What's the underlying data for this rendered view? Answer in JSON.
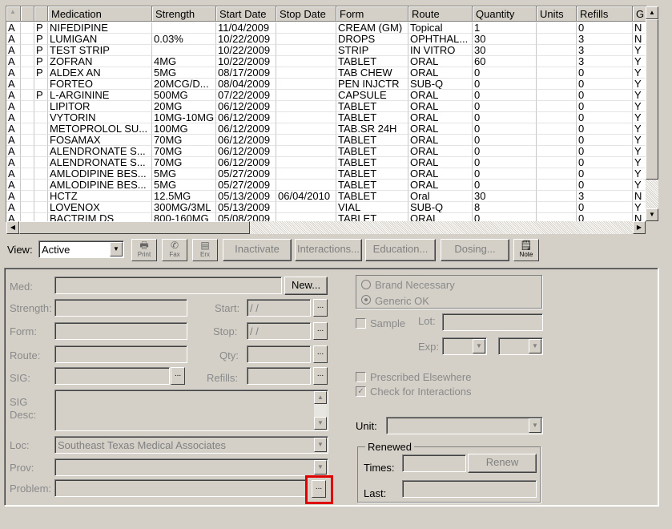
{
  "grid": {
    "columns": [
      "",
      "",
      "",
      "Medication",
      "Strength",
      "Start Date",
      "Stop Date",
      "Form",
      "Route",
      "Quantity",
      "Units",
      "Refills",
      "G"
    ],
    "rows": [
      [
        "A",
        "",
        "P",
        "NIFEDIPINE",
        "",
        "11/04/2009",
        "",
        "CREAM (GM)",
        "Topical",
        "1",
        "",
        "0",
        "N"
      ],
      [
        "A",
        "",
        "P",
        "LUMIGAN",
        "0.03%",
        "10/22/2009",
        "",
        "DROPS",
        "OPHTHAL...",
        "30",
        "",
        "3",
        "N"
      ],
      [
        "A",
        "",
        "P",
        "TEST STRIP",
        "",
        "10/22/2009",
        "",
        "STRIP",
        "IN VITRO",
        "30",
        "",
        "3",
        "Y"
      ],
      [
        "A",
        "",
        "P",
        "ZOFRAN",
        "4MG",
        "10/22/2009",
        "",
        "TABLET",
        "ORAL",
        "60",
        "",
        "3",
        "Y"
      ],
      [
        "A",
        "",
        "P",
        "ALDEX AN",
        "5MG",
        "08/17/2009",
        "",
        "TAB CHEW",
        "ORAL",
        "0",
        "",
        "0",
        "Y"
      ],
      [
        "A",
        "",
        "",
        "FORTEO",
        "20MCG/D...",
        "08/04/2009",
        "",
        "PEN INJCTR",
        "SUB-Q",
        "0",
        "",
        "0",
        "Y"
      ],
      [
        "A",
        "",
        "P",
        "L-ARGININE",
        "500MG",
        "07/22/2009",
        "",
        "CAPSULE",
        "ORAL",
        "0",
        "",
        "0",
        "Y"
      ],
      [
        "A",
        "",
        "",
        "LIPITOR",
        "20MG",
        "06/12/2009",
        "",
        "TABLET",
        "ORAL",
        "0",
        "",
        "0",
        "Y"
      ],
      [
        "A",
        "",
        "",
        "VYTORIN",
        "10MG-10MG",
        "06/12/2009",
        "",
        "TABLET",
        "ORAL",
        "0",
        "",
        "0",
        "Y"
      ],
      [
        "A",
        "",
        "",
        "METOPROLOL SU...",
        "100MG",
        "06/12/2009",
        "",
        "TAB.SR 24H",
        "ORAL",
        "0",
        "",
        "0",
        "Y"
      ],
      [
        "A",
        "",
        "",
        "FOSAMAX",
        "70MG",
        "06/12/2009",
        "",
        "TABLET",
        "ORAL",
        "0",
        "",
        "0",
        "Y"
      ],
      [
        "A",
        "",
        "",
        "ALENDRONATE S...",
        "70MG",
        "06/12/2009",
        "",
        "TABLET",
        "ORAL",
        "0",
        "",
        "0",
        "Y"
      ],
      [
        "A",
        "",
        "",
        "ALENDRONATE S...",
        "70MG",
        "06/12/2009",
        "",
        "TABLET",
        "ORAL",
        "0",
        "",
        "0",
        "Y"
      ],
      [
        "A",
        "",
        "",
        "AMLODIPINE BES...",
        "5MG",
        "05/27/2009",
        "",
        "TABLET",
        "ORAL",
        "0",
        "",
        "0",
        "Y"
      ],
      [
        "A",
        "",
        "",
        "AMLODIPINE BES...",
        "5MG",
        "05/27/2009",
        "",
        "TABLET",
        "ORAL",
        "0",
        "",
        "0",
        "Y"
      ],
      [
        "A",
        "",
        "",
        "HCTZ",
        "12.5MG",
        "05/13/2009",
        "06/04/2010",
        "TABLET",
        "Oral",
        "30",
        "",
        "3",
        "N"
      ],
      [
        "A",
        "",
        "",
        "LOVENOX",
        "300MG/3ML",
        "05/13/2009",
        "",
        "VIAL",
        "SUB-Q",
        "8",
        "",
        "0",
        "Y"
      ],
      [
        "A",
        "",
        "",
        "BACTRIM DS",
        "800-160MG",
        "05/08/2009",
        "",
        "TABLET",
        "ORAL",
        "0",
        "",
        "0",
        "N"
      ]
    ]
  },
  "toolbar": {
    "view_label": "View:",
    "view_value": "Active",
    "print": "Print",
    "fax": "Fax",
    "erx": "Erx",
    "inactivate": "Inactivate",
    "interactions": "Interactions...",
    "education": "Education...",
    "dosing": "Dosing...",
    "note": "Note"
  },
  "form": {
    "med": "Med:",
    "new_button": "New...",
    "strength": "Strength:",
    "form": "Form:",
    "route": "Route:",
    "sig": "SIG:",
    "sig_desc_1": "SIG",
    "sig_desc_2": "Desc:",
    "loc": "Loc:",
    "loc_value": "Southeast Texas Medical Associates",
    "prov": "Prov:",
    "problem": "Problem:",
    "start": "Start:",
    "start_value": " / /",
    "stop": "Stop:",
    "stop_value": " / /",
    "qty": "Qty:",
    "refills": "Refills:",
    "brand_necessary": "Brand Necessary",
    "generic_ok": "Generic OK",
    "sample": "Sample",
    "lot": "Lot:",
    "exp": "Exp:",
    "prescribed_elsewhere": "Prescribed Elsewhere",
    "check_interactions": "Check for Interactions",
    "unit": "Unit:",
    "renewed": "Renewed",
    "times": "Times:",
    "renew_button": "Renew",
    "last": "Last:",
    "ellipsis": "...",
    "highlight_color": "#e00000"
  }
}
